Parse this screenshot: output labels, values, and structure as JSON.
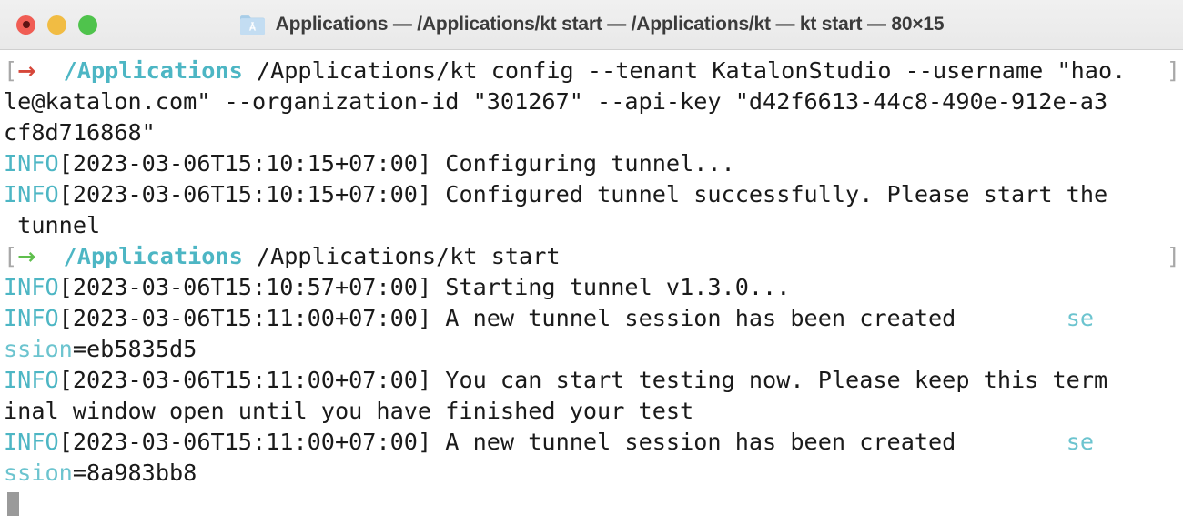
{
  "window": {
    "title": "Applications — /Applications/kt start — /Applications/kt — kt start — 80×15",
    "folder_icon": "applications-folder-icon",
    "traffic_lights": {
      "close": "close-button",
      "minimize": "minimize-button",
      "zoom": "zoom-button"
    },
    "size": "80×15"
  },
  "colors": {
    "titlebar_bg": "#ececec",
    "title_text": "#3b3b3b",
    "close": "#f05d54",
    "minimize": "#f1bc43",
    "maximize": "#4fc34c",
    "terminal_bg": "#ffffff",
    "terminal_fg": "#1a1a1a",
    "cyan": "#4db6c4",
    "prompt_error_arrow": "#d6473a",
    "prompt_ok_arrow": "#5fbf4d",
    "gray_marker": "#a8a8a8",
    "cursor": "#9a9a9a"
  },
  "terminal": {
    "lines": [
      {
        "id": "prompt-line-1",
        "type": "prompt",
        "bracket_open": "[",
        "arrow": "→",
        "arrow_state": "error",
        "cwd": "/Applications",
        "command": "/Applications/kt config --tenant KatalonStudio --username \"hao.",
        "wrap_marker": "]"
      },
      {
        "id": "prompt-line-1-wrap-a",
        "type": "wrap",
        "text": "le@katalon.com\" --organization-id \"301267\" --api-key \"d42f6613-44c8-490e-912e-a3"
      },
      {
        "id": "prompt-line-1-wrap-b",
        "type": "wrap",
        "text": "cf8d716868\""
      },
      {
        "id": "log-line-1",
        "type": "log",
        "level": "INFO",
        "timestamp": "[2023-03-06T15:10:15+07:00]",
        "message": " Configuring tunnel..."
      },
      {
        "id": "log-line-2",
        "type": "log",
        "level": "INFO",
        "timestamp": "[2023-03-06T15:10:15+07:00]",
        "message": " Configured tunnel successfully. Please start the"
      },
      {
        "id": "log-line-2-wrap",
        "type": "wrap",
        "text": " tunnel"
      },
      {
        "id": "prompt-line-2",
        "type": "prompt",
        "bracket_open": "[",
        "arrow": "→",
        "arrow_state": "ok",
        "cwd": "/Applications",
        "command": "/Applications/kt start",
        "wrap_marker": "]"
      },
      {
        "id": "log-line-3",
        "type": "log",
        "level": "INFO",
        "timestamp": "[2023-03-06T15:10:57+07:00]",
        "message": " Starting tunnel v1.3.0..."
      },
      {
        "id": "log-line-4",
        "type": "log-session",
        "level": "INFO",
        "timestamp": "[2023-03-06T15:11:00+07:00]",
        "message": " A new tunnel session has been created",
        "pad": "        ",
        "field_head": "se"
      },
      {
        "id": "log-line-4-wrap",
        "type": "session-wrap",
        "field_tail": "ssion",
        "value": "=eb5835d5"
      },
      {
        "id": "log-line-5",
        "type": "log",
        "level": "INFO",
        "timestamp": "[2023-03-06T15:11:00+07:00]",
        "message": " You can start testing now. Please keep this term"
      },
      {
        "id": "log-line-5-wrap",
        "type": "wrap",
        "text": "inal window open until you have finished your test"
      },
      {
        "id": "log-line-6",
        "type": "log-session",
        "level": "INFO",
        "timestamp": "[2023-03-06T15:11:00+07:00]",
        "message": " A new tunnel session has been created",
        "pad": "        ",
        "field_head": "se"
      },
      {
        "id": "log-line-6-wrap",
        "type": "session-wrap",
        "field_tail": "ssion",
        "value": "=8a983bb8"
      },
      {
        "id": "cursor-line",
        "type": "cursor"
      }
    ]
  }
}
